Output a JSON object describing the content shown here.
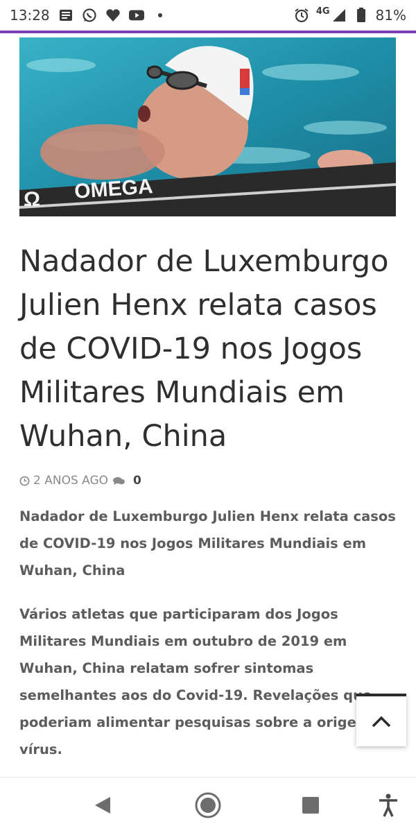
{
  "status_bar": {
    "time": "13:28",
    "network": "4G",
    "battery": "81%",
    "icons_left": [
      "news-icon",
      "whatsapp-icon",
      "heart-icon",
      "youtube-icon",
      "dot-icon"
    ],
    "icons_right": [
      "alarm-icon",
      "signal-icon",
      "battery-icon"
    ]
  },
  "colors": {
    "accent": "#7b3fb5",
    "title": "#2f2f2f",
    "body_text": "#5c5c5c",
    "meta": "#8a8a8a"
  },
  "hero": {
    "watermark": "OMEGA"
  },
  "article": {
    "title": "Nadador de Luxemburgo Julien Henx relata casos de COVID-19 nos Jogos Militares Mundiais em Wuhan, China",
    "meta": {
      "time_ago": "2 ANOS AGO",
      "comment_count": "0"
    },
    "paragraph_1": "Nadador de Luxemburgo Julien Henx relata casos de COVID-19 nos Jogos Militares Mundiais em Wuhan, China",
    "paragraph_2": "Vários atletas que participaram dos Jogos Militares Mundiais em outubro de 2019 em Wuhan, China relatam sofrer sintomas semelhantes aos do Covid-19. Revelações que poderiam alimentar pesquisas sobre a origem do vírus."
  },
  "nav": {
    "buttons": [
      "back-icon",
      "home-icon",
      "recents-icon",
      "accessibility-icon"
    ]
  }
}
